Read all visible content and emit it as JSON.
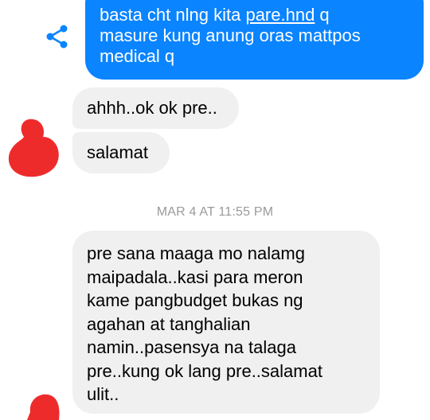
{
  "messages": {
    "outgoing": {
      "line1_before": "basta cht nlng kita ",
      "line1_link": "pare.hnd",
      "line1_after": " q",
      "line2": "masure kung anung oras mattpos",
      "line3": "medical q"
    },
    "incoming": [
      {
        "text": "ahhh..ok ok pre.."
      },
      {
        "text": "salamat"
      }
    ],
    "timestamp": "MAR 4 AT 11:55 PM",
    "incoming_long": {
      "lines": [
        "pre sana maaga mo nalamg",
        "maipadala..kasi para meron",
        "kame pangbudget bukas ng",
        "agahan at tanghalian",
        "namin..pasensya na talaga",
        "pre..kung ok lang pre..salamat",
        "ulit.."
      ]
    }
  },
  "colors": {
    "outgoing_bubble": "#0a84ff",
    "incoming_bubble": "#f0f0f0",
    "timestamp_text": "#9a9a9a",
    "share_icon": "#0a84ff",
    "redaction": "#ee2b2b"
  },
  "icons": {
    "share": "share-icon"
  }
}
